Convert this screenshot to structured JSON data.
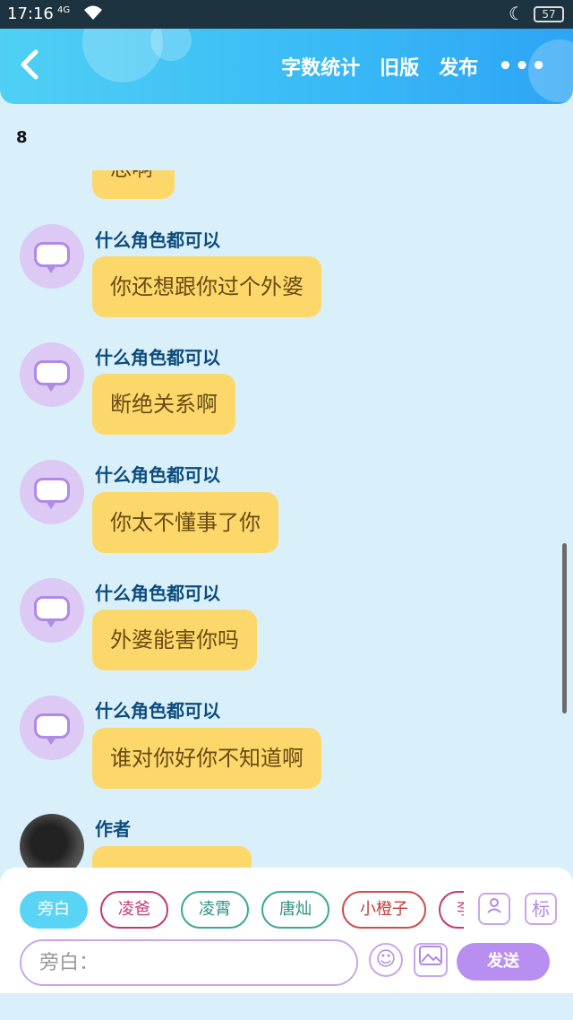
{
  "status_bar": {
    "time": "17:16",
    "network": "4G",
    "battery": "57"
  },
  "header": {
    "actions": [
      "字数统计",
      "旧版",
      "发布"
    ],
    "more_label": "•••"
  },
  "count_label": "8",
  "messages": [
    {
      "speaker": "",
      "text": "恐啊",
      "partial": true
    },
    {
      "speaker": "什么角色都可以",
      "text": "你还想跟你过个外婆"
    },
    {
      "speaker": "什么角色都可以",
      "text": "断绝关系啊"
    },
    {
      "speaker": "什么角色都可以",
      "text": "你太不懂事了你"
    },
    {
      "speaker": "什么角色都可以",
      "text": "外婆能害你吗"
    },
    {
      "speaker": "什么角色都可以",
      "text": "谁对你好你不知道啊"
    },
    {
      "speaker": "作者",
      "text": ""
    }
  ],
  "composer": {
    "chips": [
      "旁白",
      "凌爸",
      "凌霄",
      "唐灿",
      "小橙子",
      "李"
    ],
    "tools": {
      "role": "person-card-icon",
      "tag": "标"
    },
    "input_placeholder": "旁白：",
    "send_label": "发送"
  }
}
